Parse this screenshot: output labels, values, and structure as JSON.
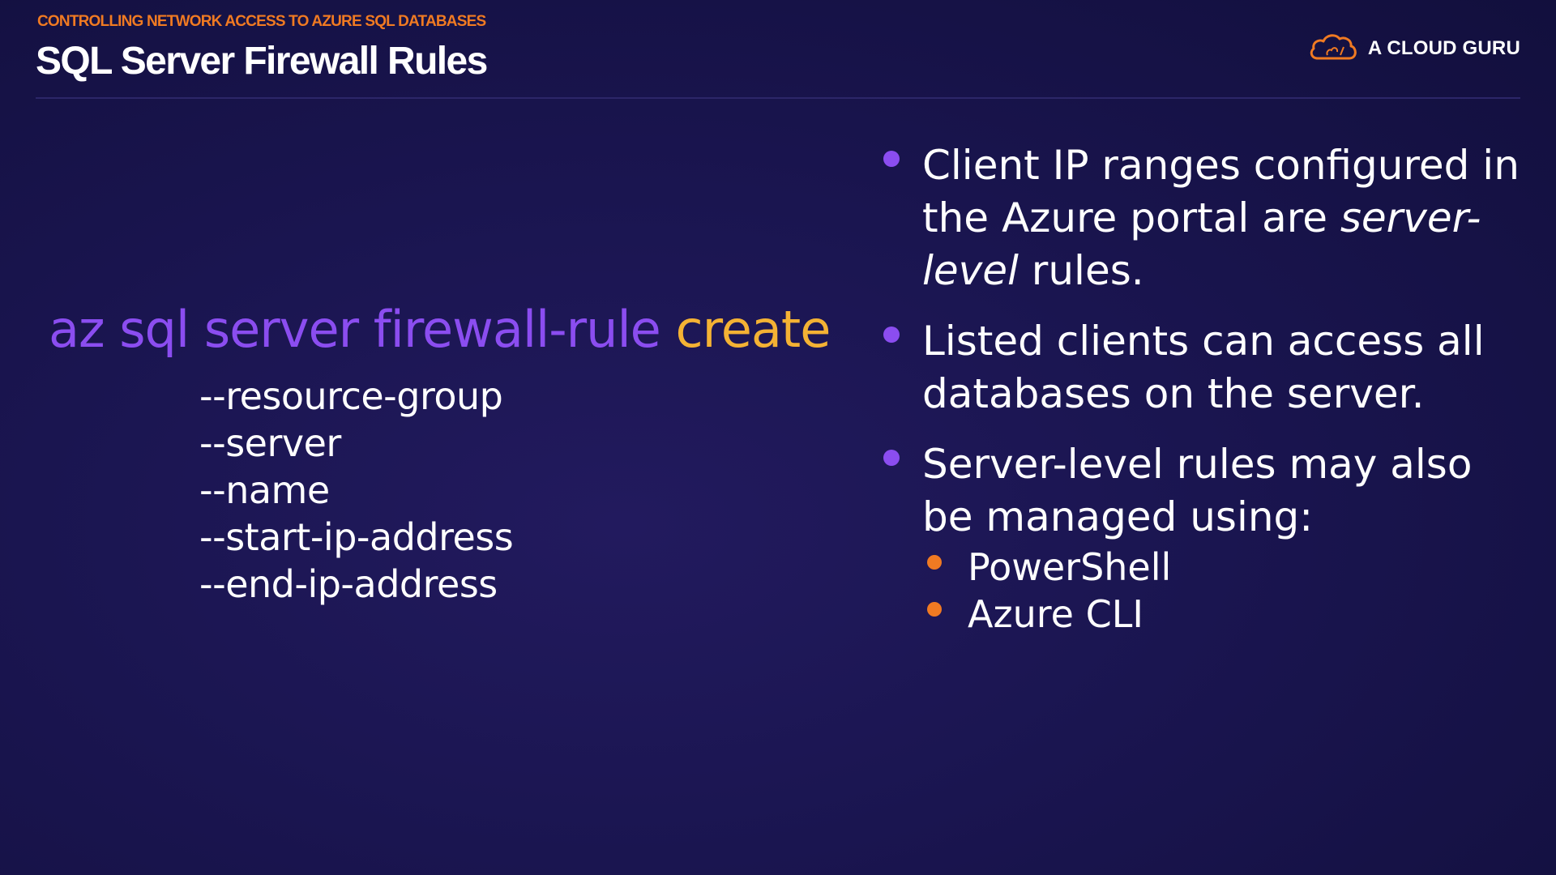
{
  "header": {
    "kicker": "CONTROLLING NETWORK ACCESS TO AZURE SQL DATABASES",
    "title": "SQL Server Firewall Rules",
    "brand": "A CLOUD GURU"
  },
  "command": {
    "base": "az sql server firewall-rule",
    "verb": "create",
    "params": [
      "--resource-group",
      "--server",
      "--name",
      "--start-ip-address",
      "--end-ip-address"
    ]
  },
  "bullets": {
    "b1": {
      "before": "Client IP ranges configured in the Azure portal are ",
      "emphasis": "server-level",
      "after": " rules."
    },
    "b2": "Listed clients can access all databases on the server.",
    "b3": "Server-level rules may also be managed using:",
    "sub": [
      "PowerShell",
      "Azure CLI"
    ]
  },
  "colors": {
    "accent_purple": "#8b4df0",
    "accent_orange": "#f07a22",
    "accent_yellow": "#f4b234",
    "background": "#1a1550"
  },
  "icons": {
    "logo": "cloud-logo-icon",
    "bullet": "bullet-dot-icon"
  }
}
